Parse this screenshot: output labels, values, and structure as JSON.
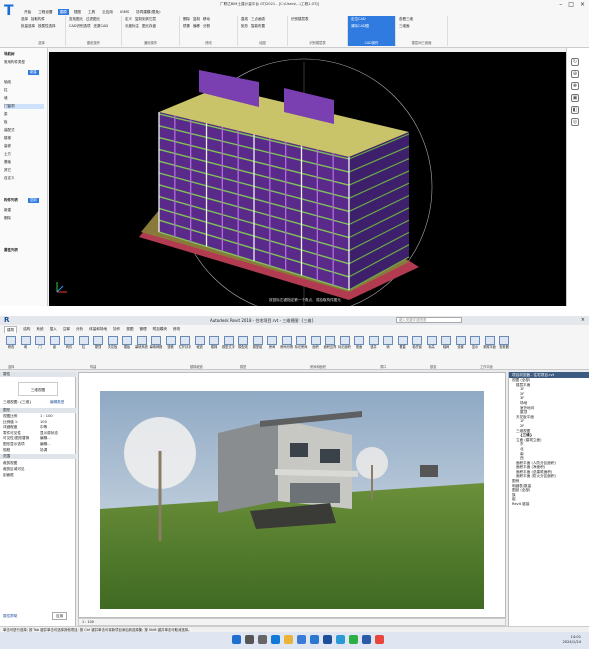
{
  "top": {
    "title": "广联达BIM土建计量平台 GTJ2021 - [C:\\Users\\...\\工程1.GTJ]",
    "tabs": [
      "开始",
      "工程设置",
      "建模",
      "视图",
      "工具",
      "云应用",
      "IGMS",
      "协同建模(限免)"
    ],
    "active_tab": "建模",
    "groups": [
      {
        "caption": "选择",
        "rows": [
          "选择",
          "拾取构件",
          "批量选择",
          "按属性选择"
        ]
      },
      {
        "caption": "图纸操作",
        "rows": [
          "查找图元",
          "过滤图元",
          "CAD识别选项",
          "还原CAD"
        ]
      },
      {
        "caption": "通用操作",
        "rows": [
          "定义",
          "复制到其它层",
          "长度标注",
          "图元存盘"
        ]
      },
      {
        "caption": "修改",
        "rows": [
          "删除",
          "复制",
          "移动",
          "镜像",
          "偏移",
          "分割"
        ]
      },
      {
        "caption": "绘图",
        "rows": [
          "直线",
          "三点画弧",
          "矩形",
          "智能布置"
        ]
      },
      {
        "caption": "识别楼层表",
        "rows": [
          "识别楼层表"
        ]
      },
      {
        "caption": "CAD操作",
        "rows": [
          "定位CAD",
          "清除CAD图"
        ]
      },
      {
        "caption": "楼层间三维面",
        "rows": [
          "查看三维",
          "三维面"
        ]
      }
    ],
    "left_items": [
      "导航树",
      "常用构件类型",
      "轴线",
      "柱",
      "墙",
      "门窗洞",
      "梁",
      "板",
      "装配式",
      "楼梯",
      "装修",
      "土方",
      "基础",
      "其它",
      "自定义",
      "构件列表",
      "新建",
      "删除",
      "属性列表"
    ],
    "left_buttons": [
      "新建",
      "复制"
    ],
    "toolbar_icons": [
      "rotate-icon",
      "zoom-icon",
      "pan-icon",
      "fit-icon",
      "section-icon",
      "camera-icon",
      "display-icon",
      "layer-icon"
    ],
    "view_hint": "按鼠标左键指定第一个角点，或拾取构件图元"
  },
  "bottom": {
    "title": "Autodesk Revit 2018 - 住宅项目.rvt - 三维视图: {三维}",
    "search_placeholder": "键入关键字或短语",
    "tabs": [
      "建筑",
      "结构",
      "系统",
      "插入",
      "注释",
      "分析",
      "体量和场地",
      "协作",
      "视图",
      "管理",
      "附加模块",
      "修改"
    ],
    "active_tab": "建筑",
    "ribbon_icons": [
      "修改",
      "墙",
      "门",
      "窗",
      "构件",
      "柱",
      "屋顶",
      "天花板",
      "楼板",
      "幕墙系统",
      "幕墙网格",
      "竖梃",
      "栏杆扶手",
      "坡道",
      "楼梯",
      "模型文字",
      "模型线",
      "模型组",
      "房间",
      "房间分隔",
      "标记房间",
      "面积",
      "面积边界",
      "标记面积",
      "按面",
      "竖井",
      "墙",
      "垂直",
      "老虎窗",
      "标高",
      "轴网",
      "设置",
      "显示",
      "参照平面",
      "查看器"
    ],
    "ribbon_groups": [
      "选择",
      "构建",
      "楼梯坡道",
      "模型",
      "房间和面积",
      "洞口",
      "基准",
      "工作平面"
    ],
    "properties": {
      "header": "属性",
      "type": "三维视图",
      "selector": "三维视图: {三维}",
      "edit_type": "编辑类型",
      "section_graphics": "图形",
      "rows": [
        [
          "视图比例",
          "1 : 100"
        ],
        [
          "比例值 1:",
          "100"
        ],
        [
          "详细程度",
          "中等"
        ],
        [
          "零件可见性",
          "显示原状态"
        ],
        [
          "可见性/图形替换",
          "编辑..."
        ],
        [
          "图形显示选项",
          "编辑..."
        ],
        [
          "规程",
          "协调"
        ]
      ],
      "section_camera": "范围",
      "rows2": [
        [
          "裁剪视图",
          ""
        ],
        [
          "裁剪区域可见",
          ""
        ],
        [
          "剖面框",
          ""
        ]
      ],
      "apply": "应用",
      "help": "属性帮助"
    },
    "browser": {
      "header": "项目浏览器 - 住宅项目.rvt",
      "nodes": [
        "视图 (全部)",
        "楼层平面",
        "1F",
        "2F",
        "3F",
        "场地",
        "室外地坪",
        "屋顶",
        "天花板平面",
        "1F",
        "2F",
        "三维视图",
        "{三维}",
        "立面 (建筑立面)",
        "东",
        "北",
        "南",
        "西",
        "面积平面 (人防分区面积)",
        "面积平面 (净面积)",
        "面积平面 (总建筑面积)",
        "面积平面 (防火分区面积)",
        "图例",
        "明细表/数量",
        "图纸 (全部)",
        "族",
        "组",
        "Revit 链接"
      ]
    },
    "view_bar": "1 : 100",
    "status": "单击可进行选择; 按 Tab 键并单击可选择其他项目; 按 Ctrl 键并单击可将新项目添加到选择集; 按 Shift 键并单击可取消选择。",
    "status_right": "主模型",
    "taskbar_icons": [
      "windows-icon",
      "search-icon",
      "taskview-icon",
      "edge-icon",
      "explorer-icon",
      "store-icon",
      "mail-icon",
      "revit-icon",
      "glodon-icon",
      "wechat-icon",
      "word-icon",
      "chrome-icon"
    ],
    "clock_time": "14:01",
    "clock_date": "2024/1/24"
  }
}
